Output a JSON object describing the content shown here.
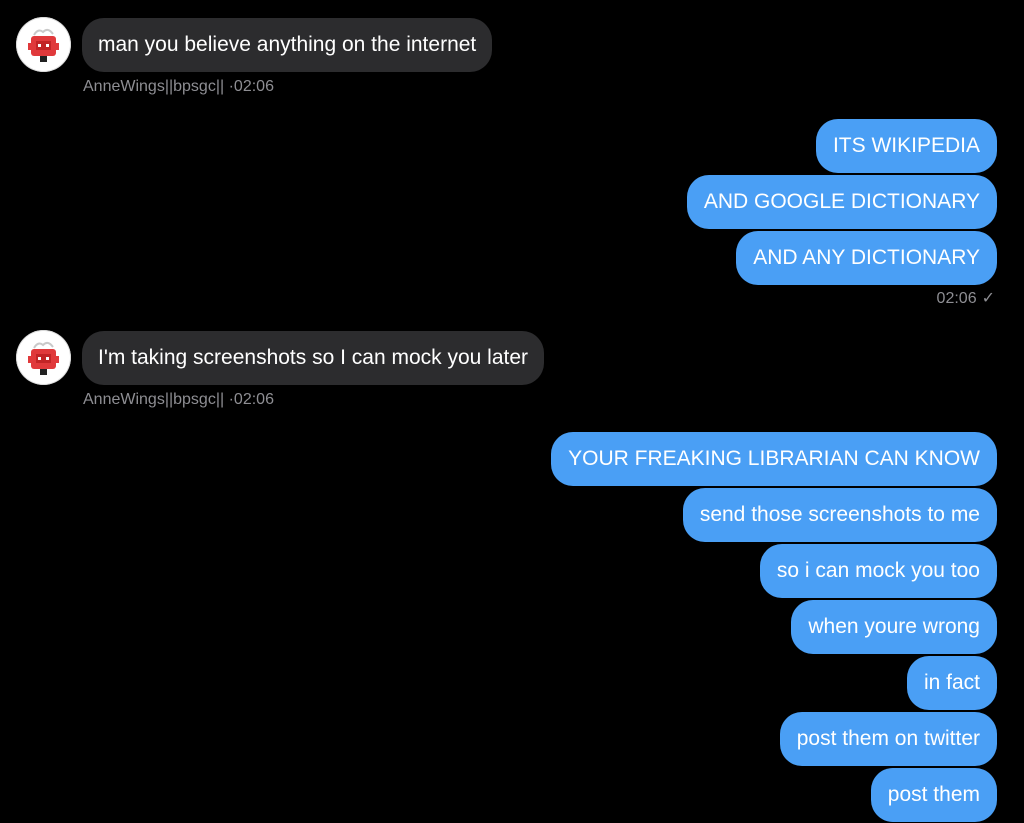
{
  "colors": {
    "background": "#000000",
    "incoming_bubble": "#2c2c2e",
    "outgoing_bubble": "#4a9ff5",
    "meta_text": "#8e8e93"
  },
  "messages": {
    "in_1": {
      "text": "man you believe anything on the internet",
      "sender": "AnneWings||bpsgc||",
      "time": "·02:06",
      "avatar": "red-robot-avatar"
    },
    "out_group_1": {
      "items": [
        "ITS WIKIPEDIA",
        "AND GOOGLE DICTIONARY",
        "AND ANY DICTIONARY"
      ],
      "time": "02:06",
      "status_icon": "check-icon"
    },
    "in_2": {
      "text": "I'm taking screenshots so I can mock you later",
      "sender": "AnneWings||bpsgc||",
      "time": "·02:06",
      "avatar": "red-robot-avatar"
    },
    "out_group_2": {
      "items": [
        "YOUR FREAKING LIBRARIAN CAN KNOW",
        "send those screenshots to me",
        "so i can mock you too",
        "when youre wrong",
        "in fact",
        "post them on twitter",
        "post them"
      ]
    },
    "check_glyph": "✓"
  }
}
